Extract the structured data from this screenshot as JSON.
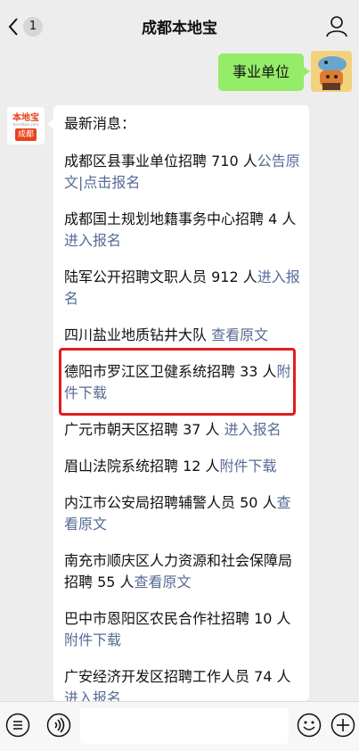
{
  "topbar": {
    "back_count": "1",
    "title": "成都本地宝"
  },
  "sent": {
    "text": "事业单位"
  },
  "bot_avatar": {
    "logo_text": "本地宝",
    "logo_sub": "bendibao.com",
    "badge_text": "成都"
  },
  "received": {
    "heading": "最新消息：",
    "items": [
      {
        "text": "成都区县事业单位招聘 710 人",
        "link": "公告原文|点击报名"
      },
      {
        "text": "成都国土规划地籍事务中心招聘 4 人",
        "link": "进入报名"
      },
      {
        "text": "陆军公开招聘文职人员 912 人",
        "link": "进入报名"
      },
      {
        "text": "四川盐业地质钻井大队",
        "link": "查看原文"
      },
      {
        "text": "德阳市罗江区卫健系统招聘 33 人",
        "link": "附件下载"
      },
      {
        "text": "广元市朝天区招聘 37 人",
        "link": "进入报名"
      },
      {
        "text": "眉山法院系统招聘 12 人",
        "link": "附件下载"
      },
      {
        "text": "内江市公安局招聘辅警人员 50 人",
        "link": "查看原文"
      },
      {
        "text": "南充市顺庆区人力资源和社会保障局招聘 55 人",
        "link": "查看原文"
      },
      {
        "text": "巴中市恩阳区农民合作社招聘 10 人",
        "link": "附件下载"
      },
      {
        "text": "广安经济开发区招聘工作人员 74 人",
        "link": "进入报名"
      }
    ]
  },
  "colors": {
    "link": "#576b95",
    "sent_bubble": "#95ec69",
    "highlight_border": "#e01d1d"
  }
}
